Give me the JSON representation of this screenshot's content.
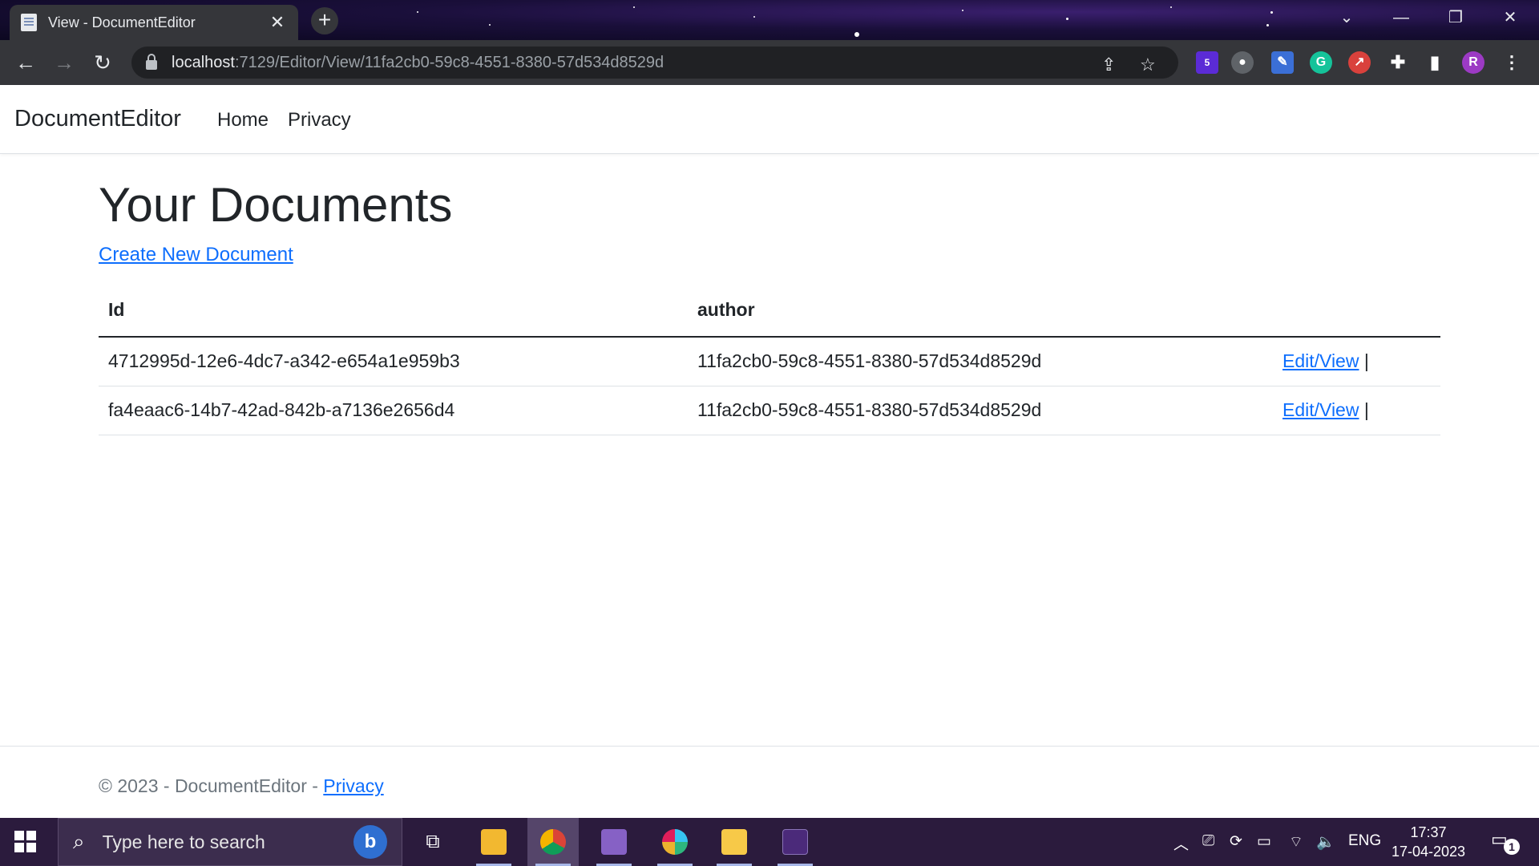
{
  "browser": {
    "tab_title": "View - DocumentEditor",
    "url_host": "localhost",
    "url_path": ":7129/Editor/View/11fa2cb0-59c8-4551-8380-57d534d8529d",
    "extension_badge": "5",
    "profile_initial": "R"
  },
  "app": {
    "brand": "DocumentEditor",
    "nav": {
      "home": "Home",
      "privacy": "Privacy"
    }
  },
  "main": {
    "title": "Your Documents",
    "create_link": "Create New Document",
    "table": {
      "headers": {
        "id": "Id",
        "author": "author"
      },
      "rows": [
        {
          "id": "4712995d-12e6-4dc7-a342-e654a1e959b3",
          "author": "11fa2cb0-59c8-4551-8380-57d534d8529d",
          "action": "Edit/View",
          "sep": "|"
        },
        {
          "id": "fa4eaac6-14b7-42ad-842b-a7136e2656d4",
          "author": "11fa2cb0-59c8-4551-8380-57d534d8529d",
          "action": "Edit/View",
          "sep": "|"
        }
      ]
    }
  },
  "footer": {
    "text": "© 2023 - DocumentEditor - ",
    "privacy_link": "Privacy"
  },
  "taskbar": {
    "search_placeholder": "Type here to search",
    "language": "ENG",
    "time": "17:37",
    "date": "17-04-2023",
    "notification_count": "1"
  },
  "colors": {
    "link": "#0d6efd",
    "text": "#212529",
    "muted": "#6c757d",
    "taskbar": "#2b1b3d",
    "chrome_toolbar": "#35363a"
  }
}
